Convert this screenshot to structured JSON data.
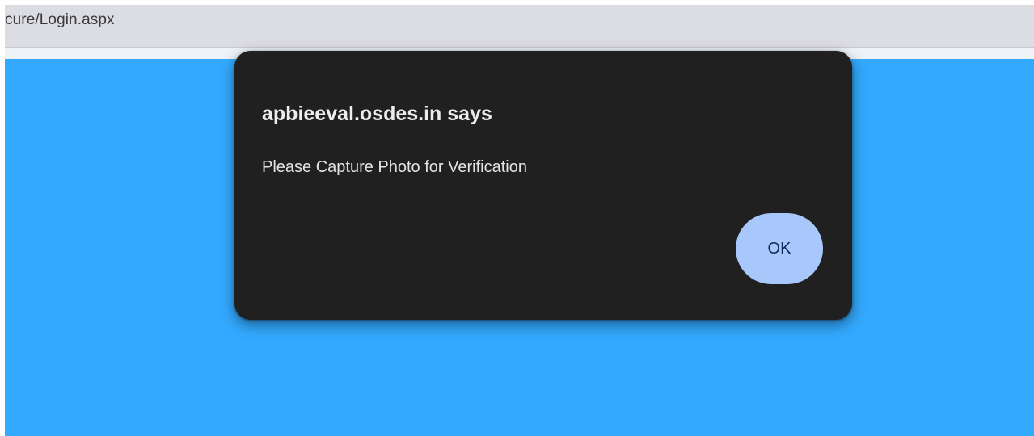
{
  "browser": {
    "address_text": "cure/Login.aspx"
  },
  "dialog": {
    "title": "apbieeval.osdes.in says",
    "message": "Please Capture Photo for Verification",
    "ok_label": "OK"
  },
  "colors": {
    "page_background": "#33aaff",
    "dialog_background": "#202020",
    "ok_button": "#a8c7fa",
    "address_bar": "#dcdde2"
  }
}
